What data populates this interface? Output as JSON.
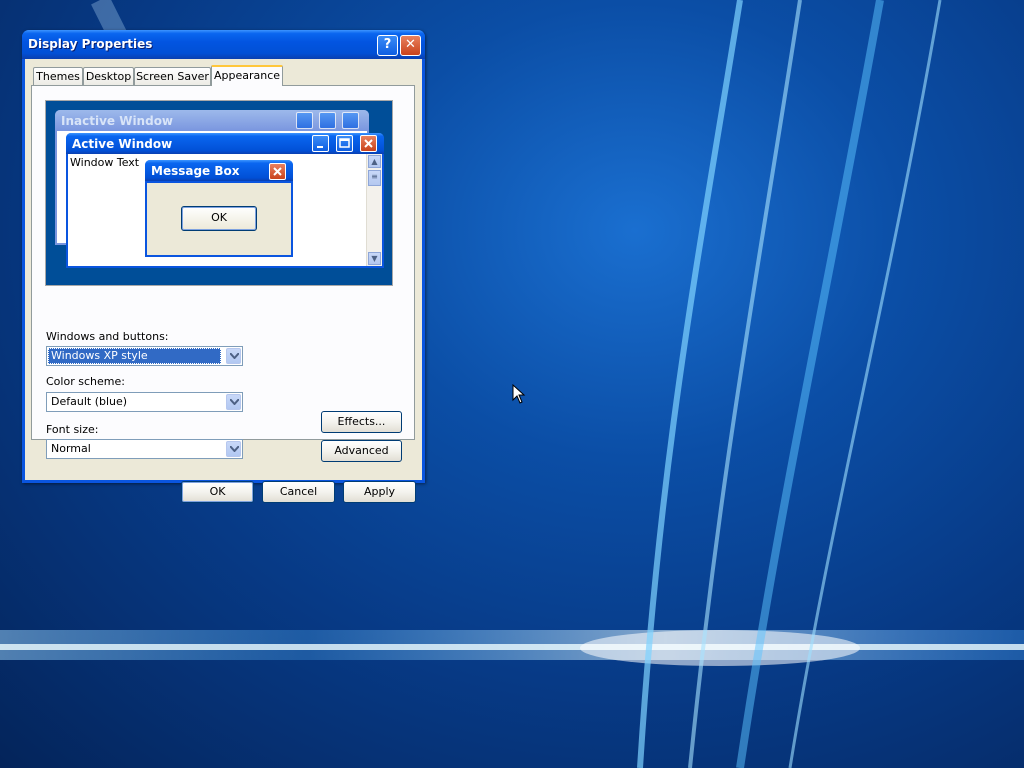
{
  "window": {
    "title": "Display Properties",
    "help_label": "?",
    "close_label": "✕"
  },
  "tabs": [
    {
      "label": "Themes"
    },
    {
      "label": "Desktop"
    },
    {
      "label": "Screen Saver"
    },
    {
      "label": "Appearance",
      "active": true
    }
  ],
  "preview": {
    "inactive_title": "Inactive Window",
    "active_title": "Active Window",
    "window_text": "Window Text",
    "message_box_title": "Message Box",
    "message_box_ok": "OK"
  },
  "fields": {
    "windows_buttons_label": "Windows and buttons:",
    "windows_buttons_value": "Windows XP style",
    "color_scheme_label": "Color scheme:",
    "color_scheme_value": "Default (blue)",
    "font_size_label": "Font size:",
    "font_size_value": "Normal"
  },
  "side_buttons": {
    "effects": "Effects...",
    "advanced": "Advanced"
  },
  "footer": {
    "ok": "OK",
    "cancel": "Cancel",
    "apply": "Apply"
  },
  "colors": {
    "titlebar": "#0150d6",
    "dialog_bg": "#ece9d8",
    "active_tab_accent": "#ffc73c",
    "selection": "#316ac5"
  }
}
